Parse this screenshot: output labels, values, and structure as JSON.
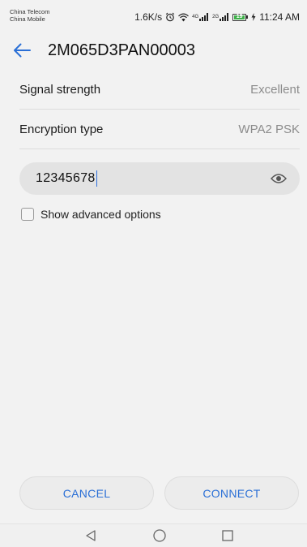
{
  "status_bar": {
    "carrier_1": "China Telecom",
    "carrier_2": "China Mobile",
    "net_speed": "1.6K/s",
    "sim1_label": "4G",
    "sim2_label": "2G",
    "battery_level": "19",
    "time": "11:24 AM",
    "icons": [
      "alarm-icon",
      "wifi-icon",
      "signal-icon",
      "signal-icon",
      "battery-icon",
      "charging-icon"
    ]
  },
  "header": {
    "back_icon": "arrow-left-icon",
    "title": "2M065D3PAN00003"
  },
  "details": [
    {
      "label": "Signal strength",
      "value": "Excellent"
    },
    {
      "label": "Encryption type",
      "value": "WPA2 PSK"
    }
  ],
  "password": {
    "value": "12345678",
    "toggle_icon": "eye-icon"
  },
  "advanced": {
    "label": "Show advanced options",
    "checked": false
  },
  "buttons": {
    "cancel": "CANCEL",
    "connect": "CONNECT"
  },
  "nav": {
    "back_icon": "triangle-back-icon",
    "home_icon": "circle-home-icon",
    "recents_icon": "square-recents-icon"
  },
  "colors": {
    "accent": "#2a6fd6",
    "background": "#f2f2f2",
    "field_bg": "#e3e3e3",
    "secondary_text": "#8c8c8c",
    "battery": "#3fb04a"
  }
}
